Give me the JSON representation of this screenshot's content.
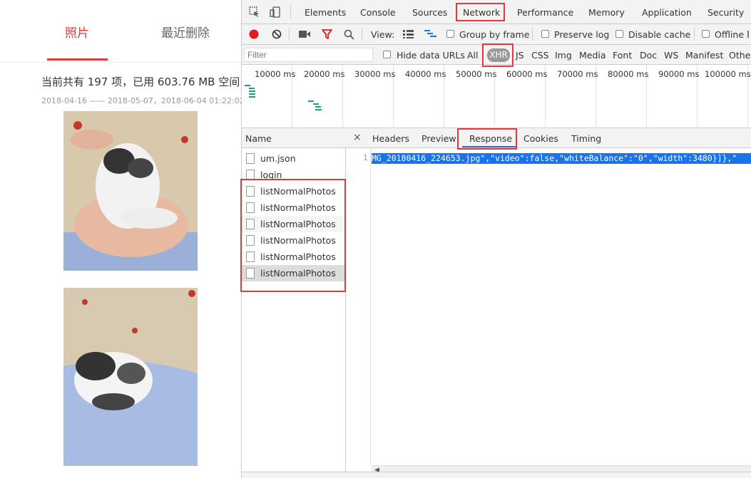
{
  "photo_page": {
    "tabs": [
      {
        "label": "照片"
      },
      {
        "label": "最近删除"
      }
    ],
    "summary": "当前共有 197 项，已用 603.76 MB 空间",
    "dates": "2018-04-16 —— 2018-05-07，2018-06-04 01:22:02"
  },
  "devtools": {
    "top_tabs": [
      "Elements",
      "Console",
      "Sources",
      "Network",
      "Performance",
      "Memory",
      "Application",
      "Security"
    ],
    "toolbar": {
      "view_label": "View:",
      "group_by_frame": "Group by frame",
      "preserve_log": "Preserve log",
      "disable_cache": "Disable cache",
      "offline": "Offline"
    },
    "filter_bar": {
      "filter_placeholder": "Filter",
      "hide_data_urls": "Hide data URLs",
      "types": [
        "All",
        "XHR",
        "JS",
        "CSS",
        "Img",
        "Media",
        "Font",
        "Doc",
        "WS",
        "Manifest",
        "Other"
      ]
    },
    "timeline_labels": [
      "10000 ms",
      "20000 ms",
      "30000 ms",
      "40000 ms",
      "50000 ms",
      "60000 ms",
      "70000 ms",
      "80000 ms",
      "90000 ms",
      "100000 ms"
    ],
    "requests_header": "Name",
    "requests": [
      "um.json",
      "login",
      "listNormalPhotos",
      "listNormalPhotos",
      "listNormalPhotos",
      "listNormalPhotos",
      "listNormalPhotos",
      "listNormalPhotos"
    ],
    "detail_tabs": [
      "Headers",
      "Preview",
      "Response",
      "Cookies",
      "Timing"
    ],
    "response": {
      "line_number": "1",
      "text": "MG_20180416_224653.jpg\",\"video\":false,\"whiteBalance\":\"0\",\"width\":3480}]},\""
    },
    "colors": {
      "accent": "#1a73e8",
      "highlight": "#e03a3a",
      "record": "#e31b1b"
    }
  }
}
